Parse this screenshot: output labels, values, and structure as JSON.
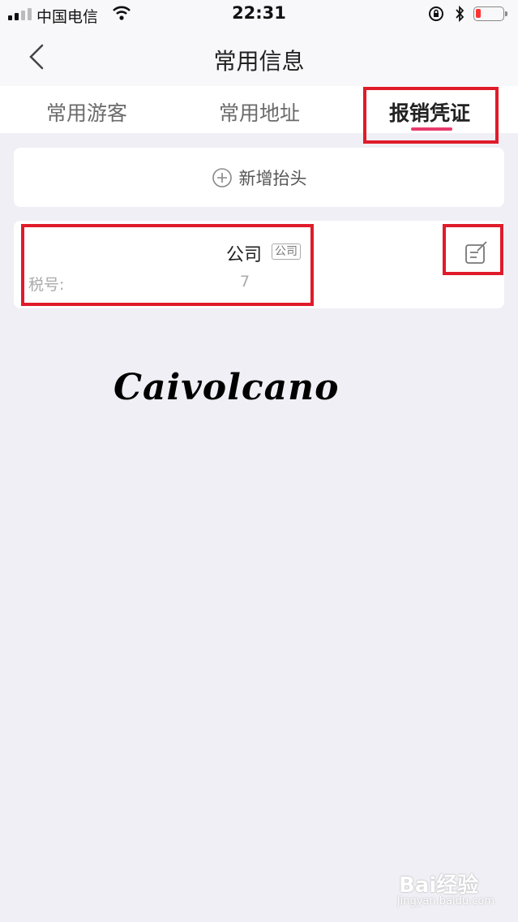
{
  "status_bar": {
    "carrier": "中国电信",
    "time": "22:31",
    "icons": [
      "signal-icon",
      "wifi-icon",
      "rotation-lock-icon",
      "bluetooth-icon",
      "battery-icon"
    ],
    "battery_color": "#ff3333"
  },
  "nav": {
    "title": "常用信息",
    "back_icon": "chevron-left-icon"
  },
  "tabs": [
    {
      "label": "常用游客",
      "active": false
    },
    {
      "label": "常用地址",
      "active": false
    },
    {
      "label": "报销凭证",
      "active": true
    }
  ],
  "accent_color": "#e83a6b",
  "annotation_color": "#e01b2a",
  "add_card": {
    "icon": "add-circle-icon",
    "label": "新增抬头"
  },
  "invoice": {
    "company_name": "公司",
    "badge": "公司",
    "tax_label": "税号:",
    "tax_value": "7",
    "edit_icon": "edit-icon"
  },
  "watermark": {
    "script_text": "Caivolcano",
    "baidu_logo": "Bai经验",
    "baidu_url": "jingyan.baidu.com"
  }
}
